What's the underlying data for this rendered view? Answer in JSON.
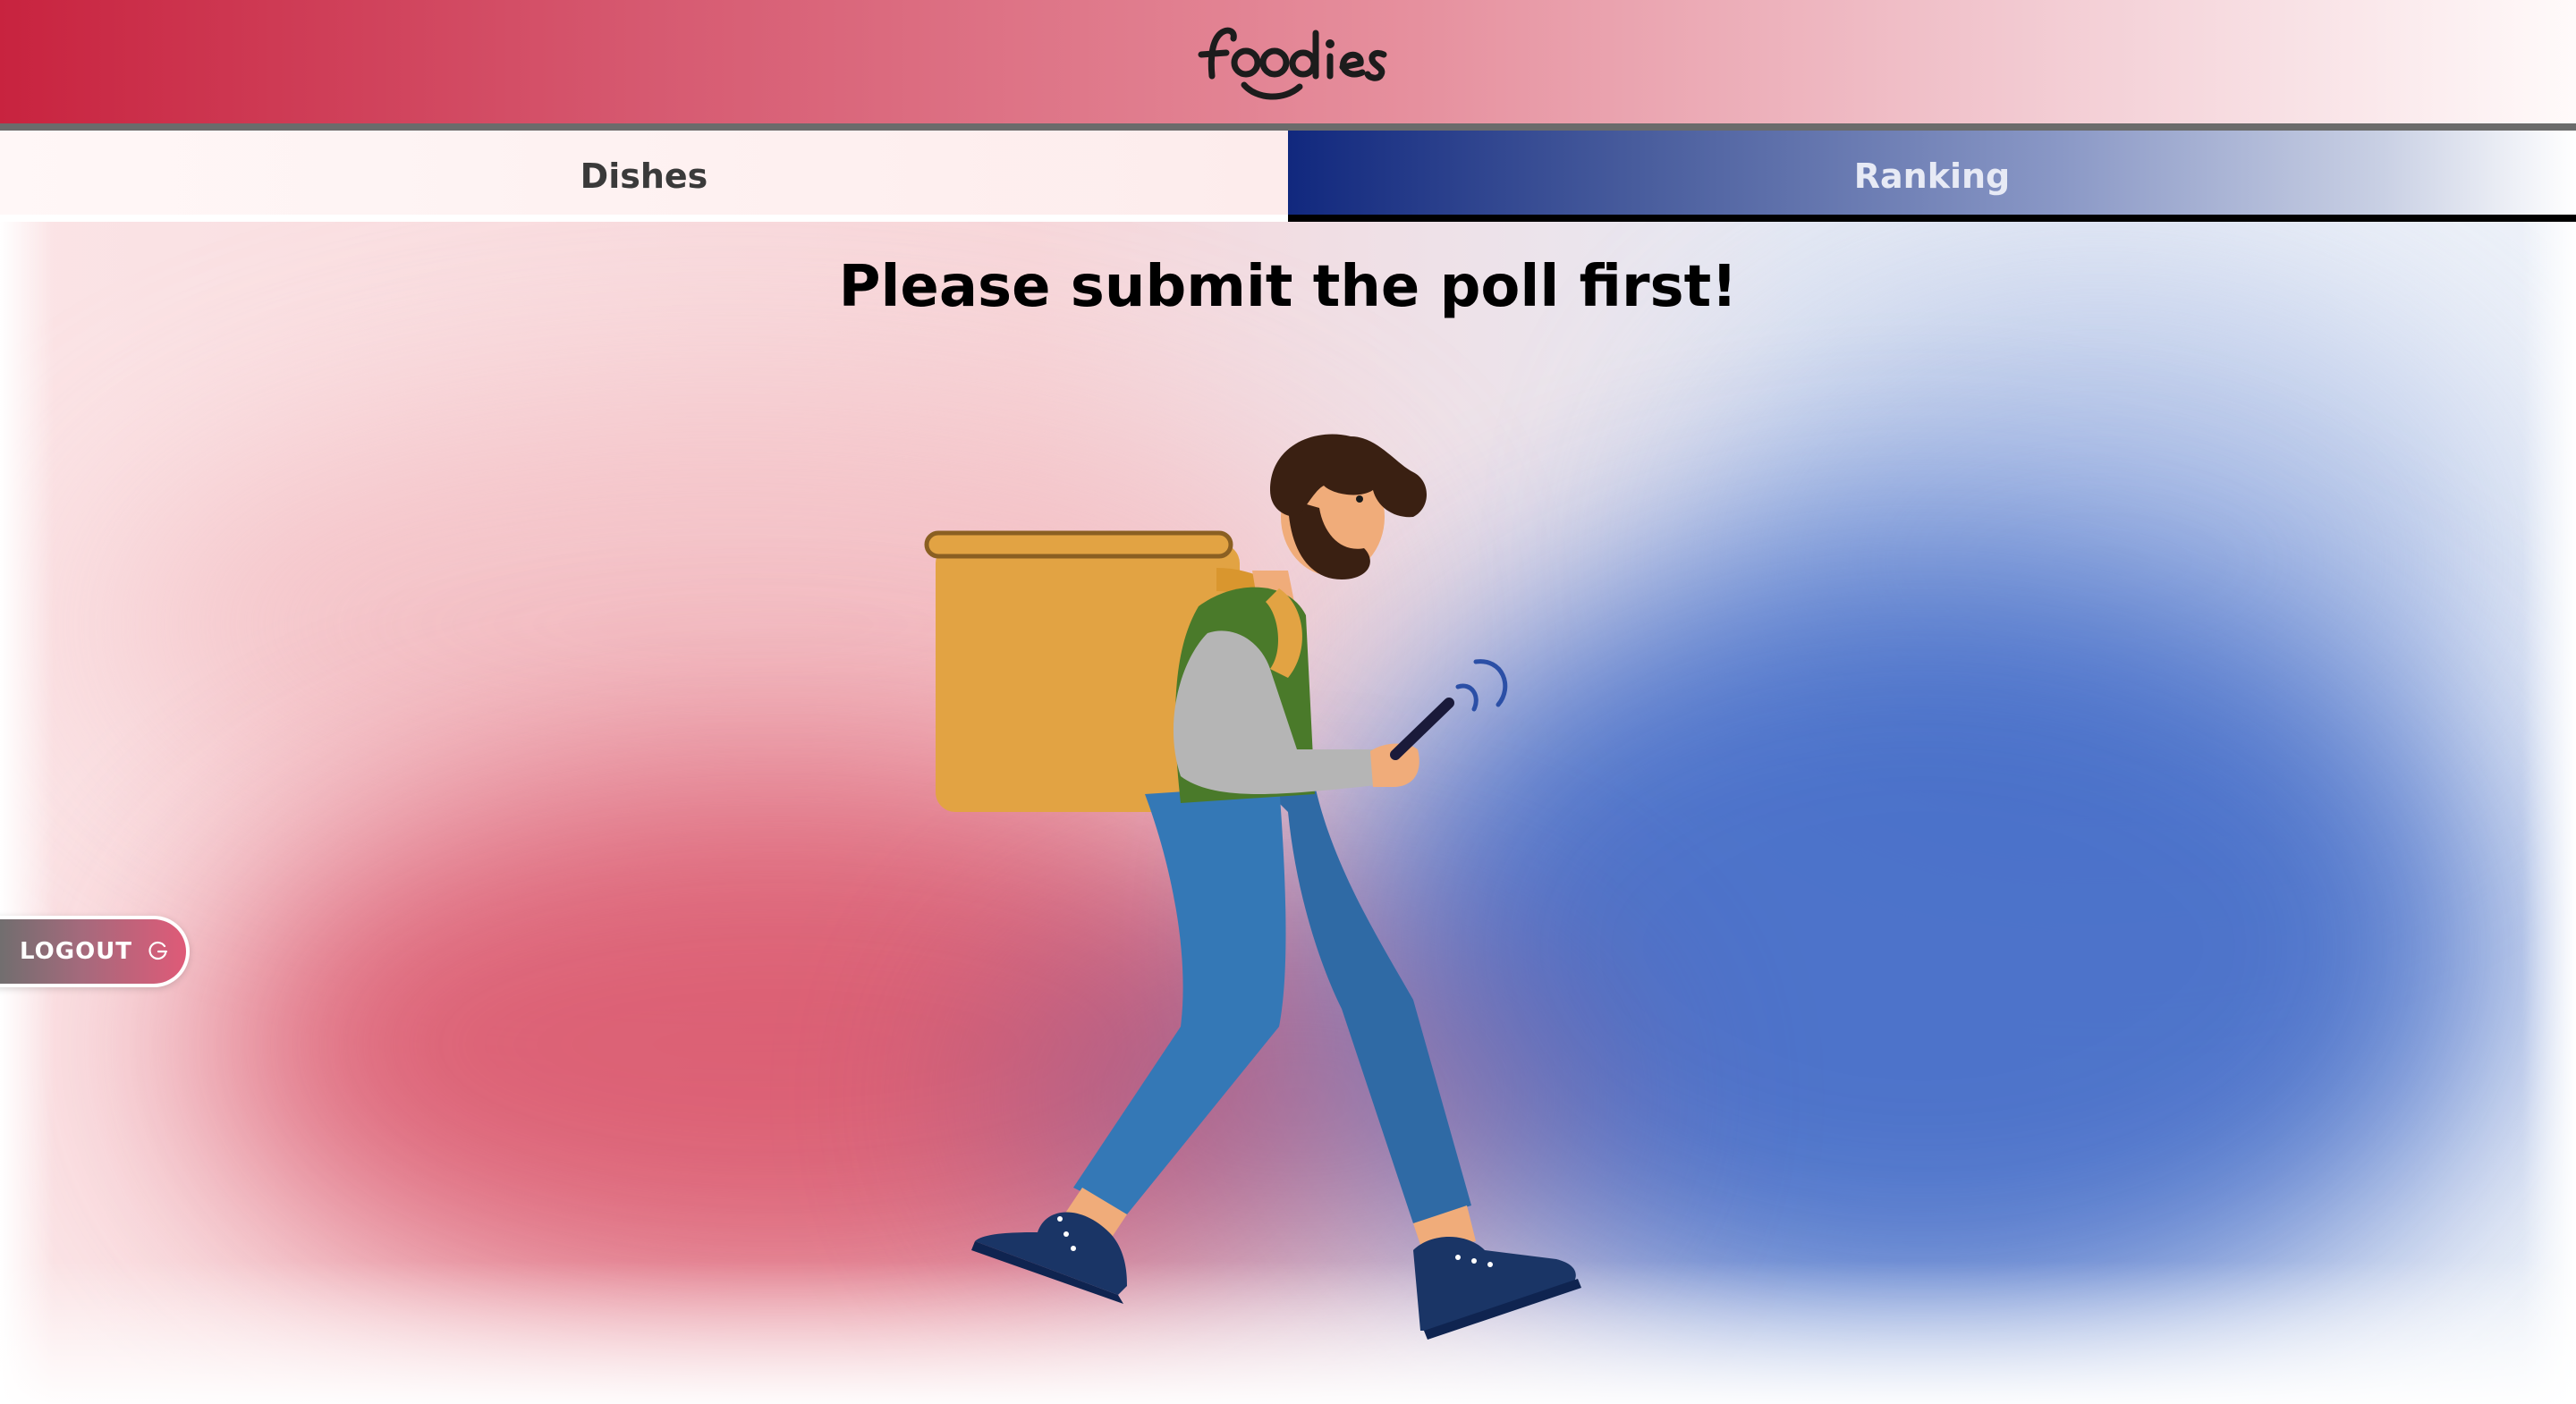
{
  "header": {
    "brand_icon": "foodies-logo"
  },
  "tabs": [
    {
      "label": "Dishes",
      "active": false
    },
    {
      "label": "Ranking",
      "active": true
    }
  ],
  "main": {
    "message": "Please submit the poll first!",
    "illustration_icon": "delivery-person-illustration"
  },
  "logout": {
    "label": "LOGOUT",
    "icon": "logout-icon"
  },
  "colors": {
    "header_red": "#c8233f",
    "ranking_blue": "#11287e",
    "backpack": "#e2a343",
    "pants": "#3478b6",
    "vest": "#4a7a2a",
    "shoes": "#1a3566"
  }
}
